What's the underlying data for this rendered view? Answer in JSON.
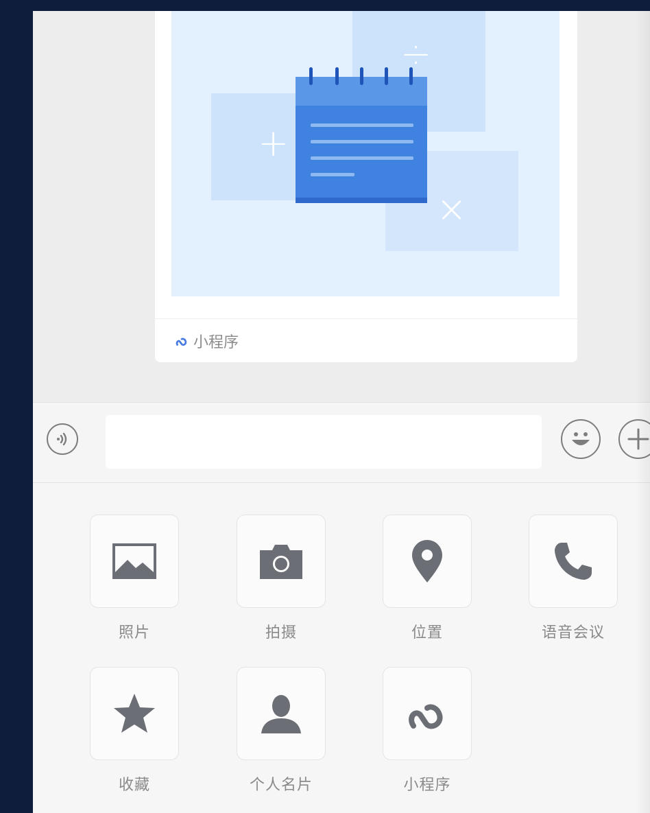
{
  "card": {
    "footer_label": "小程序"
  },
  "input_bar": {
    "text_value": "",
    "voice_icon": "voice-icon",
    "emoji_icon": "emoji-icon",
    "plus_icon": "plus-icon"
  },
  "panel": {
    "items": [
      {
        "label": "照片",
        "icon": "photo-icon"
      },
      {
        "label": "拍摄",
        "icon": "camera-icon"
      },
      {
        "label": "位置",
        "icon": "location-icon"
      },
      {
        "label": "语音会议",
        "icon": "phone-icon"
      },
      {
        "label": "收藏",
        "icon": "star-icon"
      },
      {
        "label": "个人名片",
        "icon": "person-icon"
      },
      {
        "label": "小程序",
        "icon": "mini-program-icon"
      }
    ]
  },
  "colors": {
    "icon_gray": "#6b6e75",
    "accent_blue": "#3f82e0",
    "background": "#ededed"
  }
}
